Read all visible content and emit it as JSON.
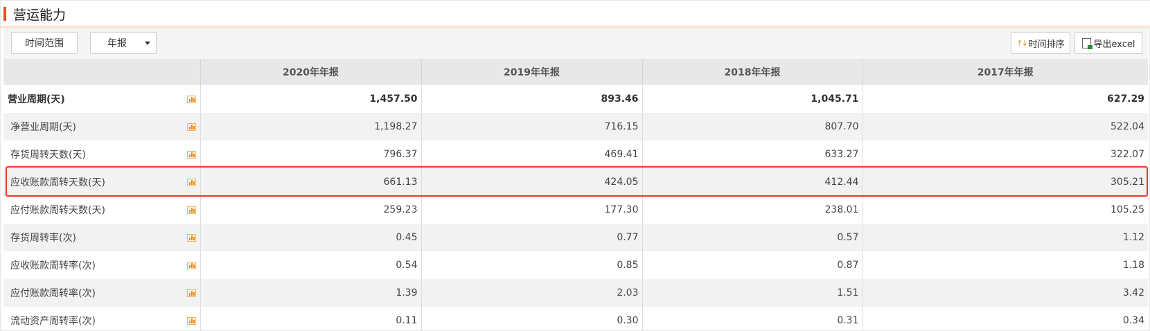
{
  "title": "营运能力",
  "toolbar": {
    "range_label": "时间范围",
    "report_type": "年报",
    "sort_label": "时间排序",
    "export_label": "导出excel"
  },
  "table": {
    "headers": [
      "",
      "2020年年报",
      "2019年年报",
      "2018年年报",
      "2017年年报"
    ],
    "rows": [
      {
        "label": "营业周期(天)",
        "values": [
          "1,457.50",
          "893.46",
          "1,045.71",
          "627.29"
        ]
      },
      {
        "label": "净营业周期(天)",
        "values": [
          "1,198.27",
          "716.15",
          "807.70",
          "522.04"
        ]
      },
      {
        "label": "存货周转天数(天)",
        "values": [
          "796.37",
          "469.41",
          "633.27",
          "322.07"
        ]
      },
      {
        "label": "应收账款周转天数(天)",
        "values": [
          "661.13",
          "424.05",
          "412.44",
          "305.21"
        ]
      },
      {
        "label": "应付账款周转天数(天)",
        "values": [
          "259.23",
          "177.30",
          "238.01",
          "105.25"
        ]
      },
      {
        "label": "存货周转率(次)",
        "values": [
          "0.45",
          "0.77",
          "0.57",
          "1.12"
        ]
      },
      {
        "label": "应收账款周转率(次)",
        "values": [
          "0.54",
          "0.85",
          "0.87",
          "1.18"
        ]
      },
      {
        "label": "应付账款周转率(次)",
        "values": [
          "1.39",
          "2.03",
          "1.51",
          "3.42"
        ]
      },
      {
        "label": "流动资产周转率(次)",
        "values": [
          "0.11",
          "0.30",
          "0.31",
          "0.34"
        ]
      }
    ]
  },
  "icons": {
    "row_chart": "bar-chart-icon",
    "sort": "sort-arrows-icon",
    "export": "excel-file-icon",
    "dropdown": "caret-down-icon"
  },
  "colors": {
    "accent": "#e84f1c",
    "highlight_border": "#e53a2c",
    "chart_icon": "#f08a00"
  }
}
